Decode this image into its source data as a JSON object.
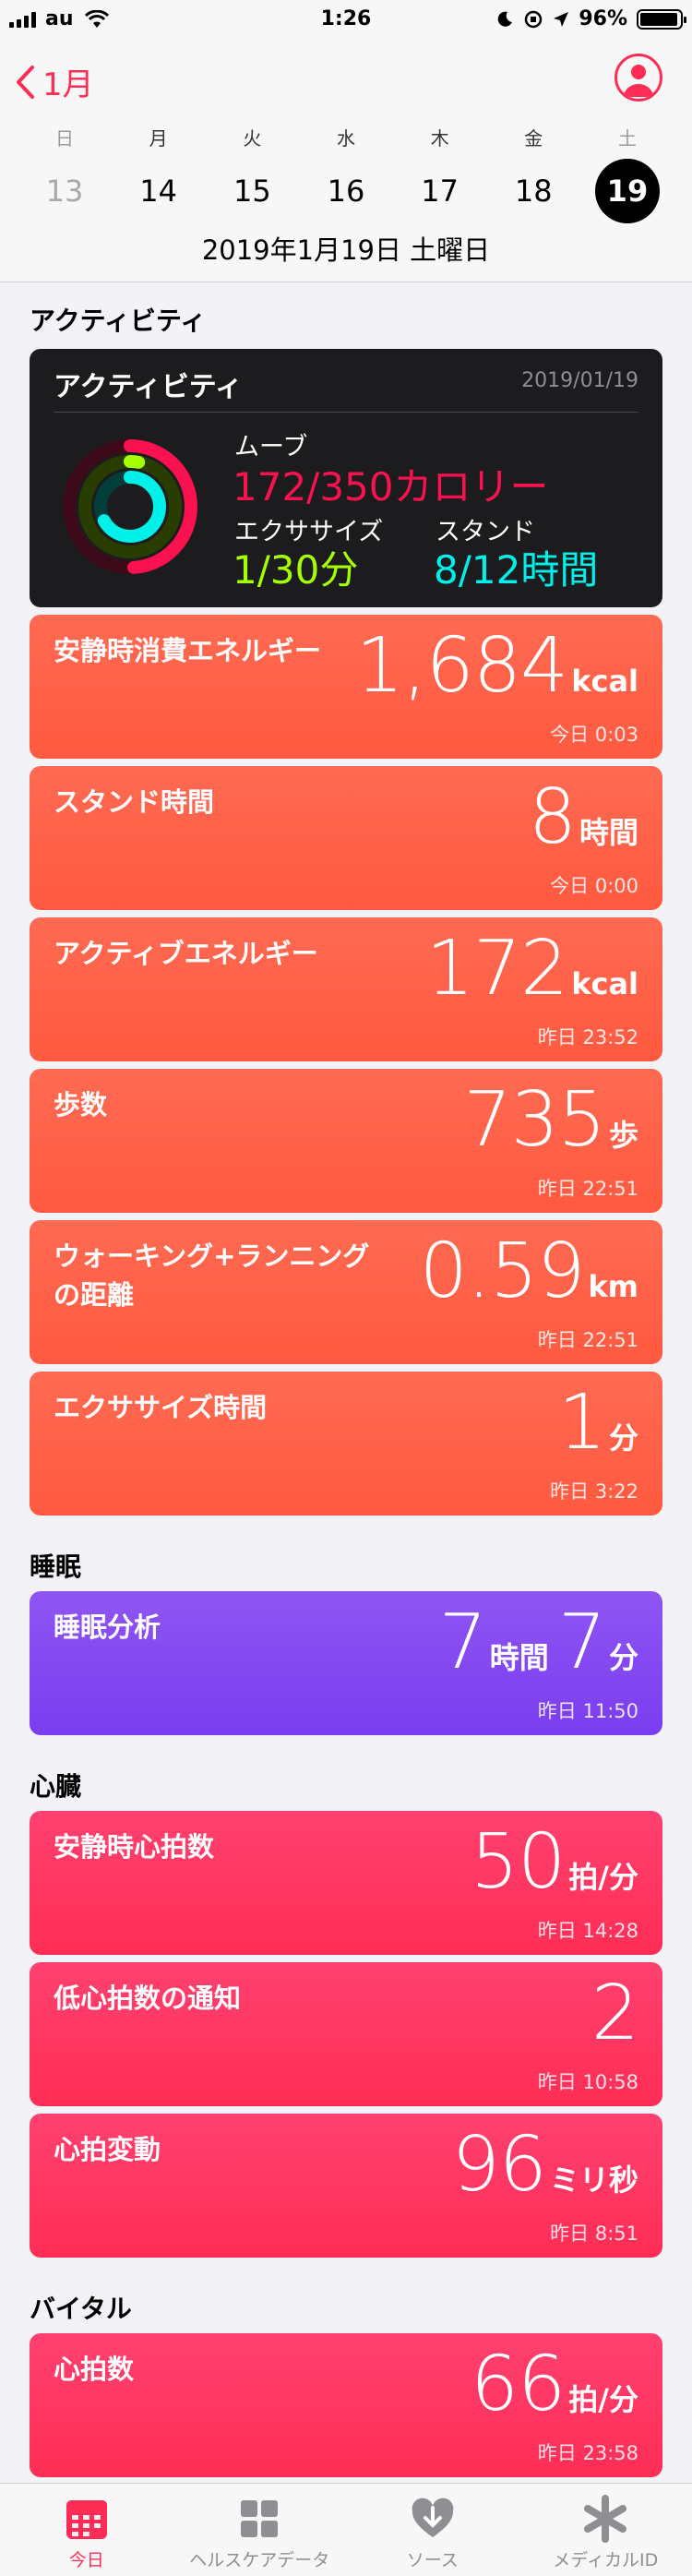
{
  "status_bar": {
    "carrier": "au",
    "time": "1:26",
    "battery": "96%",
    "battery_level": 0.96
  },
  "header": {
    "back_label": "1月",
    "weekdays": [
      "日",
      "月",
      "火",
      "水",
      "木",
      "金",
      "土"
    ],
    "dates": [
      "13",
      "14",
      "15",
      "16",
      "17",
      "18",
      "19"
    ],
    "selected_index": 6,
    "full_date": "2019年1月19日 土曜日"
  },
  "sections": {
    "activity": "アクティビティ",
    "sleep": "睡眠",
    "heart": "心臓",
    "vitals": "バイタル"
  },
  "activity_card": {
    "title": "アクティビティ",
    "date": "2019/01/19",
    "move_label": "ムーブ",
    "move_value": "172/350カロリー",
    "move_fraction": 0.49,
    "exercise_label": "エクササイズ",
    "exercise_value": "1/30分",
    "exercise_fraction": 0.03,
    "stand_label": "スタンド",
    "stand_value": "8/12時間",
    "stand_fraction": 0.67,
    "colors": {
      "move": "#fa114f",
      "exercise": "#a6ff00",
      "stand": "#00f0ea"
    }
  },
  "cards": {
    "resting_energy": {
      "title": "安静時消費エネルギー",
      "value": "1,684",
      "unit": "kcal",
      "time": "今日 0:03"
    },
    "stand_hours": {
      "title": "スタンド時間",
      "value": "8",
      "unit": "時間",
      "time": "今日 0:00"
    },
    "active_energy": {
      "title": "アクティブエネルギー",
      "value": "172",
      "unit": "kcal",
      "time": "昨日 23:52"
    },
    "steps": {
      "title": "歩数",
      "value": "735",
      "unit": "歩",
      "time": "昨日 22:51"
    },
    "walking_distance": {
      "title_line1": "ウォーキング+ランニング",
      "title_line2": "の距離",
      "value": "0.59",
      "unit": "km",
      "time": "昨日 22:51"
    },
    "exercise_time": {
      "title": "エクササイズ時間",
      "value": "1",
      "unit": "分",
      "time": "昨日 3:22"
    },
    "sleep_analysis": {
      "title": "睡眠分析",
      "hours": "7",
      "hours_unit": "時間",
      "minutes": "7",
      "minutes_unit": "分",
      "time": "昨日 11:50"
    },
    "resting_hr": {
      "title": "安静時心拍数",
      "value": "50",
      "unit": "拍/分",
      "time": "昨日 14:28"
    },
    "low_hr_notice": {
      "title": "低心拍数の通知",
      "value": "2",
      "time": "昨日 10:58"
    },
    "hrv": {
      "title": "心拍変動",
      "value": "96",
      "unit": "ミリ秒",
      "time": "昨日 8:51"
    },
    "heart_rate": {
      "title": "心拍数",
      "value": "66",
      "unit": "拍/分",
      "time": "昨日 23:58"
    }
  },
  "tabs": [
    {
      "label": "今日",
      "icon": "calendar-icon"
    },
    {
      "label": "ヘルスケアデータ",
      "icon": "grid-icon"
    },
    {
      "label": "ソース",
      "icon": "heart-download-icon"
    },
    {
      "label": "メディカルID",
      "icon": "asterisk-icon"
    }
  ],
  "colors": {
    "accent": "#ff2d55",
    "orange": "#ff5e45",
    "purple": "#8448f1",
    "pink": "#ff3366"
  }
}
